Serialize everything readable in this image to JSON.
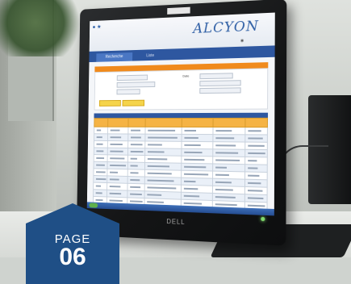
{
  "screen": {
    "app_logo": "ALCYON",
    "tabs": [
      {
        "label": "Recherche"
      },
      {
        "label": "Liste"
      }
    ],
    "form": {
      "date_label": "Date"
    }
  },
  "monitor": {
    "brand": "DELL"
  },
  "badge": {
    "label": "PAGE",
    "number": "06"
  },
  "colors": {
    "accent_orange": "#f08a1c",
    "accent_blue": "#2e57a0",
    "badge_blue": "#1f4f86"
  }
}
